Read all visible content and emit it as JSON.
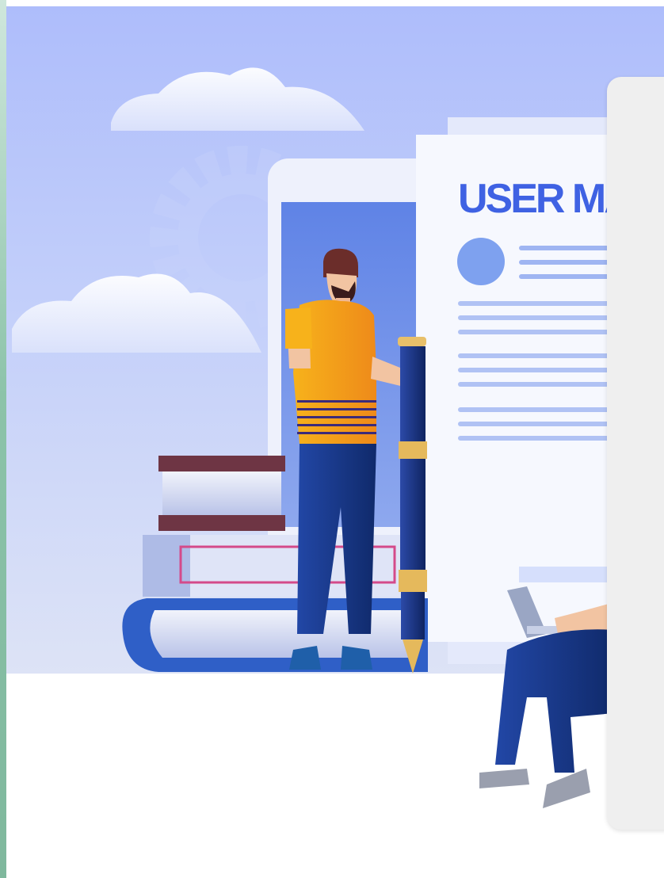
{
  "illustration": {
    "document_title": "USER MAI",
    "palette": {
      "sky_top": "#aebdfb",
      "sky_bottom": "#dde3f6",
      "accent_blue": "#3f62e3",
      "shirt_orange": "#f4a119",
      "pants_navy": "#1c3a8a",
      "book_maroon": "#6e3544",
      "panel_gray": "#efefef"
    },
    "icons": [
      "cloud-icon",
      "gear-icon",
      "pen-icon",
      "book-icon",
      "laptop-icon"
    ]
  }
}
